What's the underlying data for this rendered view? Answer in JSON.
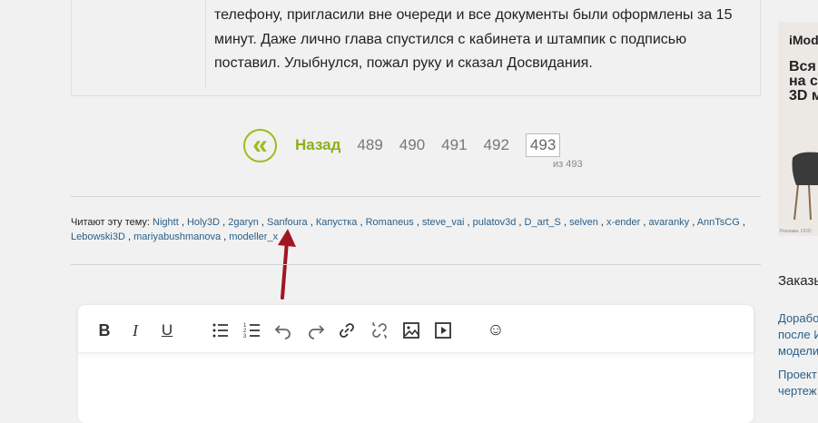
{
  "post": {
    "text": "телефону, пригласили вне очереди и все документы были оформлены за 15 минут. Даже лично глава спустился с кабинета и штампик с подписью поставил. Улыбнулся, пожал руку и сказал Досвидания."
  },
  "pagination": {
    "back_icon": "«",
    "back_label": "Назад",
    "pages": [
      "489",
      "490",
      "491",
      "492"
    ],
    "current_page": "493",
    "total_label": "из 493"
  },
  "readers": {
    "label": "Читают эту тему:",
    "names": [
      "Nightt",
      "Holy3D",
      "2garyn",
      "Sanfoura",
      "Капустка",
      "Romaneus",
      "steve_vai",
      "pulatov3d",
      "D_art_S",
      "selven",
      "x-ender",
      "avaranky",
      "AnnTsCG",
      "Lebowski3D",
      "mariyabushmanova",
      "modeller_x"
    ]
  },
  "annotation": {
    "color": "#a01623"
  },
  "editor_toolbar": {
    "bold": "B",
    "italic": "I",
    "underline": "U",
    "bullet_list": "bullet-list-icon",
    "numbered_list": "numbered-list-icon",
    "undo": "undo-icon",
    "redo": "redo-icon",
    "link": "link-icon",
    "unlink": "unlink-icon",
    "image": "image-icon",
    "media": "media-icon",
    "emoji": "☺"
  },
  "ad": {
    "brand": "iMod",
    "headline": "Вся\nна с\n3D м",
    "legal": "Реклама. ООО"
  },
  "sidebar": {
    "title": "Заказы",
    "links": [
      "Доработ\nпосле И\nмодели",
      "Проект\nчертеж"
    ]
  },
  "colors": {
    "accent": "#9bbd1d",
    "link": "#2a5f88",
    "background": "#f1f1f1"
  }
}
